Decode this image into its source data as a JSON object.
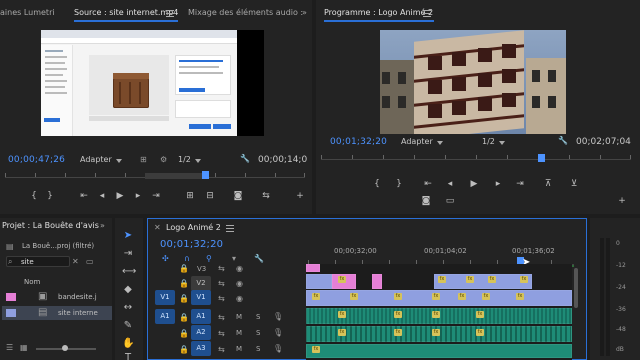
{
  "source_panel": {
    "tab_lumetri": "aines Lumetri",
    "tab_source": "Source : site internet.mp4",
    "tab_mix": "Mixage des éléments audio :",
    "more": "»",
    "timecode_left": "00;00;47;26",
    "fit": "Adapter",
    "resolution": "1/2",
    "timecode_right": "00;00;14;0"
  },
  "program_panel": {
    "tab_program": "Programme : Logo Animé 2",
    "timecode_left": "00;01;32;20",
    "fit": "Adapter",
    "resolution": "1/2",
    "timecode_right": "00;02;07;04"
  },
  "project_panel": {
    "tab": "Projet : La Bouête d'avis",
    "more": "»",
    "folder": "La Bouê...proj (filtré)",
    "search_value": "site",
    "column_name": "Nom",
    "items": [
      "bandesite.j",
      "site interne"
    ]
  },
  "timeline": {
    "tab": "Logo Animé 2",
    "timecode": "00;01;32;20",
    "ruler_labels": [
      "00;00;32;00",
      "00;01;04;02",
      "00;01;36;02"
    ],
    "tracks": [
      {
        "id": "V3",
        "toggle": ""
      },
      {
        "id": "V2",
        "toggle": ""
      },
      {
        "id": "V1",
        "toggle": "V1"
      },
      {
        "id": "A1",
        "toggle": "A1"
      },
      {
        "id": "A2",
        "toggle": ""
      },
      {
        "id": "A3",
        "toggle": ""
      }
    ],
    "mute": "M",
    "solo": "S"
  },
  "meter": {
    "labels": [
      "0",
      "-12",
      "-24",
      "-36",
      "-48",
      "dB"
    ]
  },
  "colors": {
    "accent": "#4d93ff",
    "video_clip": "#8f9fe0",
    "pink_clip": "#e57fd6",
    "audio_clip": "#1e8c77"
  }
}
